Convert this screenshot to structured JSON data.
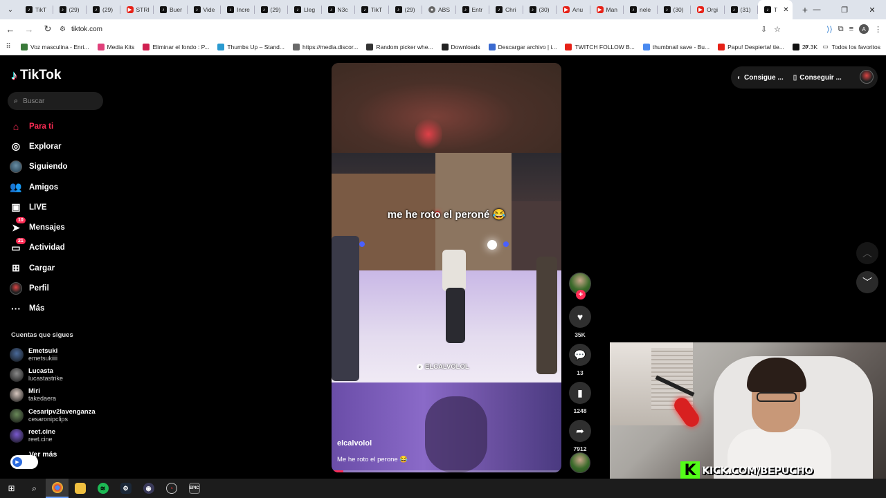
{
  "browser": {
    "tabs": [
      {
        "label": "TikT",
        "icon": "tiktok"
      },
      {
        "label": "(29)",
        "icon": "tiktok"
      },
      {
        "label": "(29)",
        "icon": "tiktok"
      },
      {
        "label": "STRI",
        "icon": "youtube"
      },
      {
        "label": "Buer",
        "icon": "tiktok"
      },
      {
        "label": "Vide",
        "icon": "tiktok"
      },
      {
        "label": "Incre",
        "icon": "tiktok"
      },
      {
        "label": "(29)",
        "icon": "tiktok"
      },
      {
        "label": "Lleg",
        "icon": "tiktok"
      },
      {
        "label": "N3c",
        "icon": "tiktok"
      },
      {
        "label": "TikT",
        "icon": "tiktok"
      },
      {
        "label": "(29)",
        "icon": "tiktok"
      },
      {
        "label": "ABS",
        "icon": "generic"
      },
      {
        "label": "Entr",
        "icon": "tiktok"
      },
      {
        "label": "Chri",
        "icon": "tiktok"
      },
      {
        "label": "(30)",
        "icon": "tiktok"
      },
      {
        "label": "Anu",
        "icon": "youtube"
      },
      {
        "label": "Man",
        "icon": "youtube"
      },
      {
        "label": "nele",
        "icon": "tiktok"
      },
      {
        "label": "(30)",
        "icon": "tiktok"
      },
      {
        "label": "Orgi",
        "icon": "youtube"
      },
      {
        "label": "(31)",
        "icon": "tiktok"
      }
    ],
    "active_tab_label": "T",
    "url": "tiktok.com",
    "bookmarks": [
      {
        "label": "Voz masculina - Enri...",
        "color": "#3a7a3a"
      },
      {
        "label": "Media Kits",
        "color": "#e0407a"
      },
      {
        "label": "Eliminar el fondo : P...",
        "color": "#d02050"
      },
      {
        "label": "Thumbs Up – Stand...",
        "color": "#2a9ad0"
      },
      {
        "label": "https://media.discor...",
        "color": "#6a6a6a"
      },
      {
        "label": "Random picker whe...",
        "color": "#333333"
      },
      {
        "label": "Downloads",
        "color": "#222222"
      },
      {
        "label": "Descargar archivo | i...",
        "color": "#3a6ad0"
      },
      {
        "label": "TWITCH FOLLOW B...",
        "color": "#e62117"
      },
      {
        "label": "thumbnail save - Bu...",
        "color": "#4a8af0"
      },
      {
        "label": "Papu! Despierta! tie...",
        "color": "#e62117"
      },
      {
        "label": "27.3K",
        "color": "#111111"
      }
    ],
    "bookmarks_folder": "Todos los favoritos"
  },
  "sidebar": {
    "logo": "TikTok",
    "search_placeholder": "Buscar",
    "nav": [
      {
        "label": "Para ti",
        "icon": "home-icon",
        "glyph": "⌂",
        "active": true
      },
      {
        "label": "Explorar",
        "icon": "compass-icon",
        "glyph": "◎"
      },
      {
        "label": "Siguiendo",
        "icon": "avatar",
        "glyph": ""
      },
      {
        "label": "Amigos",
        "icon": "friends-icon",
        "glyph": "👥"
      },
      {
        "label": "LIVE",
        "icon": "live-icon",
        "glyph": "▣"
      },
      {
        "label": "Mensajes",
        "icon": "messages-icon",
        "glyph": "➤",
        "badge": "10"
      },
      {
        "label": "Actividad",
        "icon": "activity-icon",
        "glyph": "▭",
        "badge": "21"
      },
      {
        "label": "Cargar",
        "icon": "upload-icon",
        "glyph": "⊞"
      },
      {
        "label": "Perfil",
        "icon": "profile-avatar",
        "glyph": ""
      },
      {
        "label": "Más",
        "icon": "more-icon",
        "glyph": "···"
      }
    ],
    "following_title": "Cuentas que sigues",
    "following": [
      {
        "name": "Emetsuki",
        "handle": "emetsukiiii",
        "color": "#4a6a9a"
      },
      {
        "name": "Lucasta",
        "handle": "lucastastrike",
        "color": "#8a8a8a"
      },
      {
        "name": "Miri",
        "handle": "takedaera",
        "color": "#d8c8c0"
      },
      {
        "name": "Cesaripv2lavenganza",
        "handle": "cesaronipclips",
        "color": "#6a8a5a"
      },
      {
        "name": "reet.cine",
        "handle": "reet.cine",
        "color": "#7a5ad0"
      }
    ],
    "see_more": "Ver más"
  },
  "video": {
    "overlay_text": "me he roto el peroné 😂",
    "watermark": "ELCALVOLOL",
    "author": "elcalvolol",
    "description": "Me he roto el perone 😂",
    "progress": 0.05
  },
  "actions": {
    "likes": "35K",
    "comments": "13",
    "saves": "1248",
    "shares": "7912"
  },
  "topbar": {
    "coins_label": "Consigue ...",
    "app_label": "Conseguir ..."
  },
  "webcam": {
    "overlay": "KICK.COM/BEPUCHO"
  }
}
